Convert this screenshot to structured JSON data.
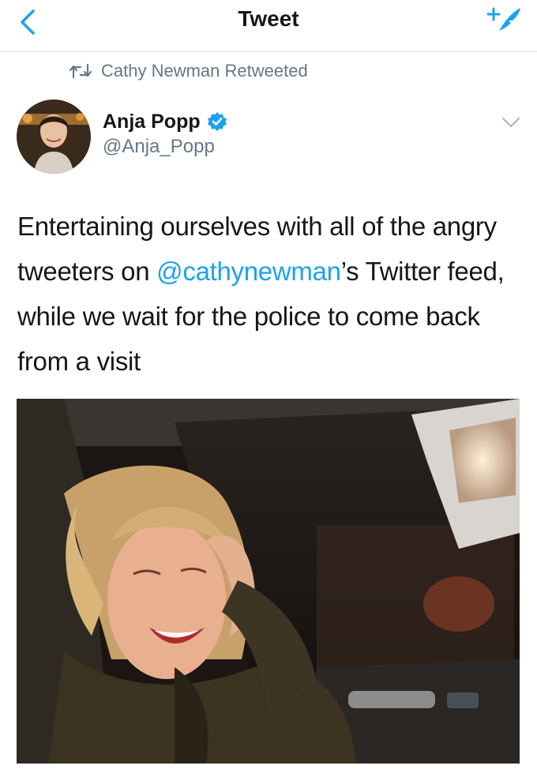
{
  "nav": {
    "title": "Tweet",
    "back_icon": "chevron-left-icon",
    "compose_icon": "compose-tweet-icon",
    "accent": "#1da1f2"
  },
  "retweet": {
    "icon": "retweet-icon",
    "text": "Cathy Newman Retweeted"
  },
  "tweet": {
    "author": {
      "name": "Anja Popp",
      "handle": "@Anja_Popp",
      "verified": true
    },
    "text_before": "Entertaining ourselves with all of the angry tweeters on ",
    "mention": "@cathynewman",
    "text_after": "’s Twitter feed, while we wait for the police to come back from a visit",
    "media": "photo-woman-laughing-in-car"
  },
  "colors": {
    "text": "#14171a",
    "secondary": "#657786",
    "link": "#1da1f2",
    "divider": "#d6d9dc"
  }
}
